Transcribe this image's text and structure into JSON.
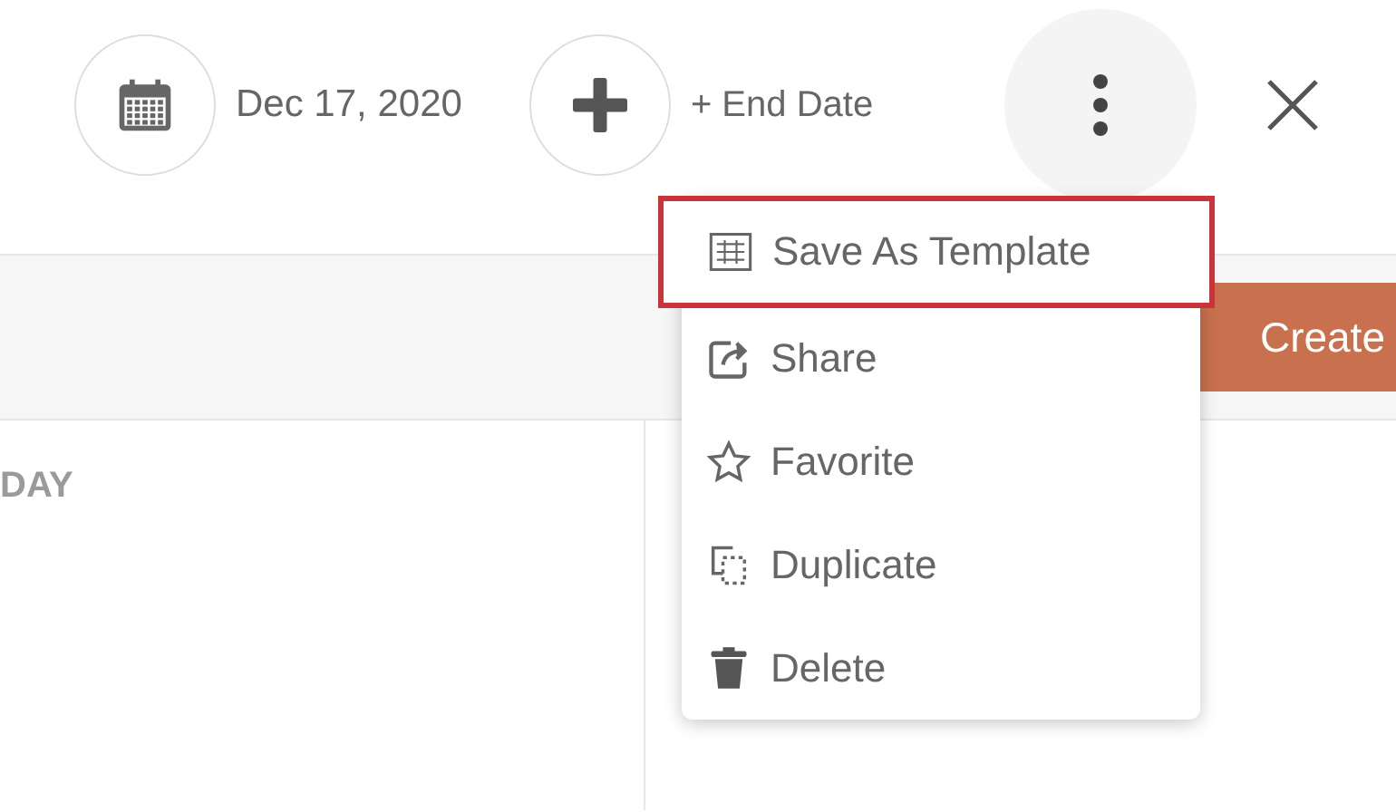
{
  "header": {
    "start_date": "Dec 17, 2020",
    "end_date_label": "+ End Date",
    "more_menu_open": true
  },
  "toolbar": {
    "create_button": "Create"
  },
  "columns": [
    {
      "heading": "DAY"
    }
  ],
  "menu": {
    "items": [
      {
        "kind": "template",
        "label": "Save As Template",
        "selected": true
      },
      {
        "kind": "share",
        "label": "Share",
        "selected": false
      },
      {
        "kind": "favorite",
        "label": "Favorite",
        "selected": false
      },
      {
        "kind": "duplicate",
        "label": "Duplicate",
        "selected": false
      },
      {
        "kind": "delete",
        "label": "Delete",
        "selected": false
      }
    ]
  }
}
